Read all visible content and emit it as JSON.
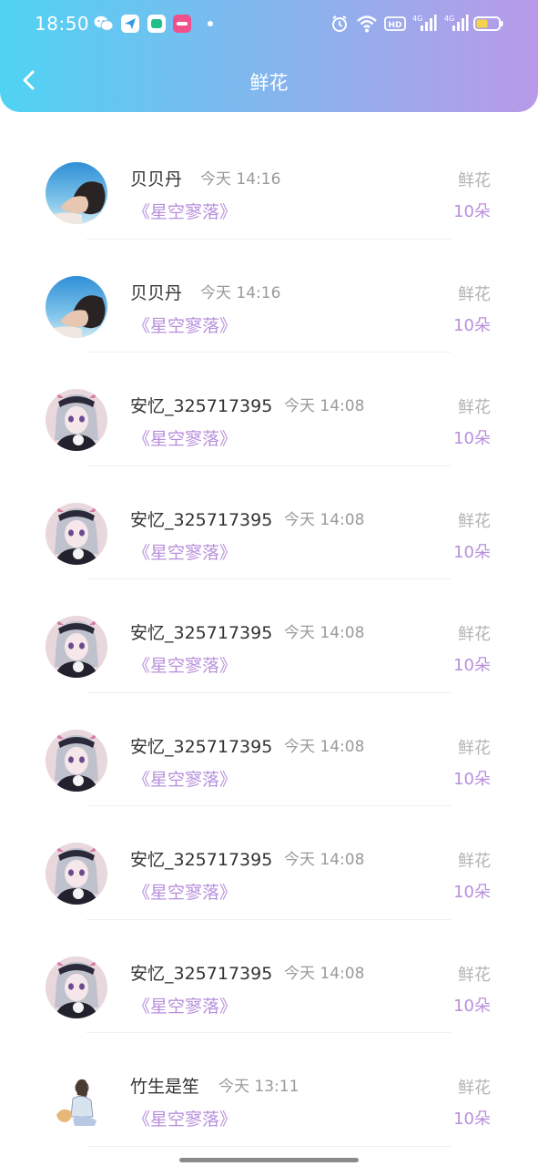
{
  "status_bar": {
    "time": "18:50",
    "app_icons": [
      {
        "name": "wechat-icon",
        "color": "#2dc100"
      },
      {
        "name": "paper-plane-icon",
        "color": "#2f9be8"
      },
      {
        "name": "chat-app-icon",
        "color": "#1fbf8a"
      },
      {
        "name": "lala-app-icon",
        "color": "#f0508c"
      }
    ],
    "network_label": "4G",
    "hd_label": "HD",
    "battery_level": 0.5
  },
  "header": {
    "title": "鲜花",
    "back_icon": "chevron-left-icon"
  },
  "colors": {
    "accent": "#b88fdc",
    "header_start": "#4fd3f3",
    "header_end": "#b99ae8"
  },
  "records": [
    {
      "name": "贝贝丹",
      "time": "今天 14:16",
      "book": "《星空寥落》",
      "gift": "鲜花",
      "count": "10朵",
      "avatar": "photo"
    },
    {
      "name": "贝贝丹",
      "time": "今天 14:16",
      "book": "《星空寥落》",
      "gift": "鲜花",
      "count": "10朵",
      "avatar": "photo"
    },
    {
      "name": "安忆_325717395",
      "time": "今天 14:08",
      "book": "《星空寥落》",
      "gift": "鲜花",
      "count": "10朵",
      "avatar": "anime"
    },
    {
      "name": "安忆_325717395",
      "time": "今天 14:08",
      "book": "《星空寥落》",
      "gift": "鲜花",
      "count": "10朵",
      "avatar": "anime"
    },
    {
      "name": "安忆_325717395",
      "time": "今天 14:08",
      "book": "《星空寥落》",
      "gift": "鲜花",
      "count": "10朵",
      "avatar": "anime"
    },
    {
      "name": "安忆_325717395",
      "time": "今天 14:08",
      "book": "《星空寥落》",
      "gift": "鲜花",
      "count": "10朵",
      "avatar": "anime"
    },
    {
      "name": "安忆_325717395",
      "time": "今天 14:08",
      "book": "《星空寥落》",
      "gift": "鲜花",
      "count": "10朵",
      "avatar": "anime"
    },
    {
      "name": "安忆_325717395",
      "time": "今天 14:08",
      "book": "《星空寥落》",
      "gift": "鲜花",
      "count": "10朵",
      "avatar": "anime"
    },
    {
      "name": "竹生是笙",
      "time": "今天 13:11",
      "book": "《星空寥落》",
      "gift": "鲜花",
      "count": "10朵",
      "avatar": "sketch"
    }
  ]
}
